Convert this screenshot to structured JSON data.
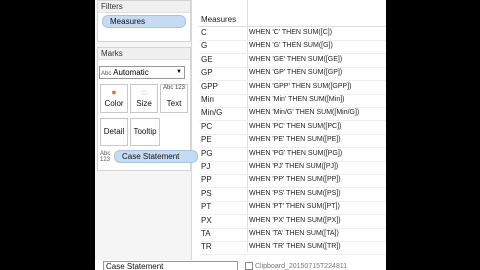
{
  "filters": {
    "title": "Filters",
    "pill": "Measures"
  },
  "marks": {
    "title": "Marks",
    "type_select": "Automatic",
    "type_icon_text": "Abc",
    "buttons": [
      {
        "label": "Color",
        "icon": "color-icon"
      },
      {
        "label": "Size",
        "icon": "size-icon"
      },
      {
        "label": "Text",
        "icon": "text-icon",
        "icon_text": "Abc 123"
      },
      {
        "label": "Detail",
        "icon": "detail-icon"
      },
      {
        "label": "Tooltip",
        "icon": "tooltip-icon"
      }
    ],
    "field_icon_text": "Abc 123",
    "field_pill": "Case Statement"
  },
  "table": {
    "header": "Measures",
    "rows": [
      {
        "k": "C",
        "v": "WHEN 'C' THEN SUM([C])"
      },
      {
        "k": "G",
        "v": "WHEN 'G' THEN SUM([G])"
      },
      {
        "k": "GE",
        "v": "WHEN 'GE' THEN SUM([GE])"
      },
      {
        "k": "GP",
        "v": "WHEN 'GP' THEN SUM([GP])"
      },
      {
        "k": "GPP",
        "v": "WHEN 'GPP' THEN SUM([GPP])"
      },
      {
        "k": "Min",
        "v": "WHEN 'Min' THEN SUM([Min])"
      },
      {
        "k": "Min/G",
        "v": "WHEN 'Min/G' THEN SUM([Min/G])"
      },
      {
        "k": "PC",
        "v": "WHEN 'PC' THEN SUM([PC])"
      },
      {
        "k": "PE",
        "v": "WHEN 'PE' THEN SUM([PE])"
      },
      {
        "k": "PG",
        "v": "WHEN 'PG' THEN SUM([PG])"
      },
      {
        "k": "PJ",
        "v": "WHEN 'PJ' THEN SUM([PJ])"
      },
      {
        "k": "PP",
        "v": "WHEN 'PP' THEN SUM([PP])"
      },
      {
        "k": "PS",
        "v": "WHEN 'PS' THEN SUM([PS])"
      },
      {
        "k": "PT",
        "v": "WHEN 'PT' THEN SUM([PT])"
      },
      {
        "k": "PX",
        "v": "WHEN 'PX' THEN SUM([PX])"
      },
      {
        "k": "TA",
        "v": "WHEN 'TA' THEN SUM([TA])"
      },
      {
        "k": "TR",
        "v": "WHEN 'TR' THEN SUM([TR])"
      }
    ]
  },
  "bottom": {
    "input_value": "Case Statement",
    "clipboard": "Clipboard_20150715T224811"
  }
}
